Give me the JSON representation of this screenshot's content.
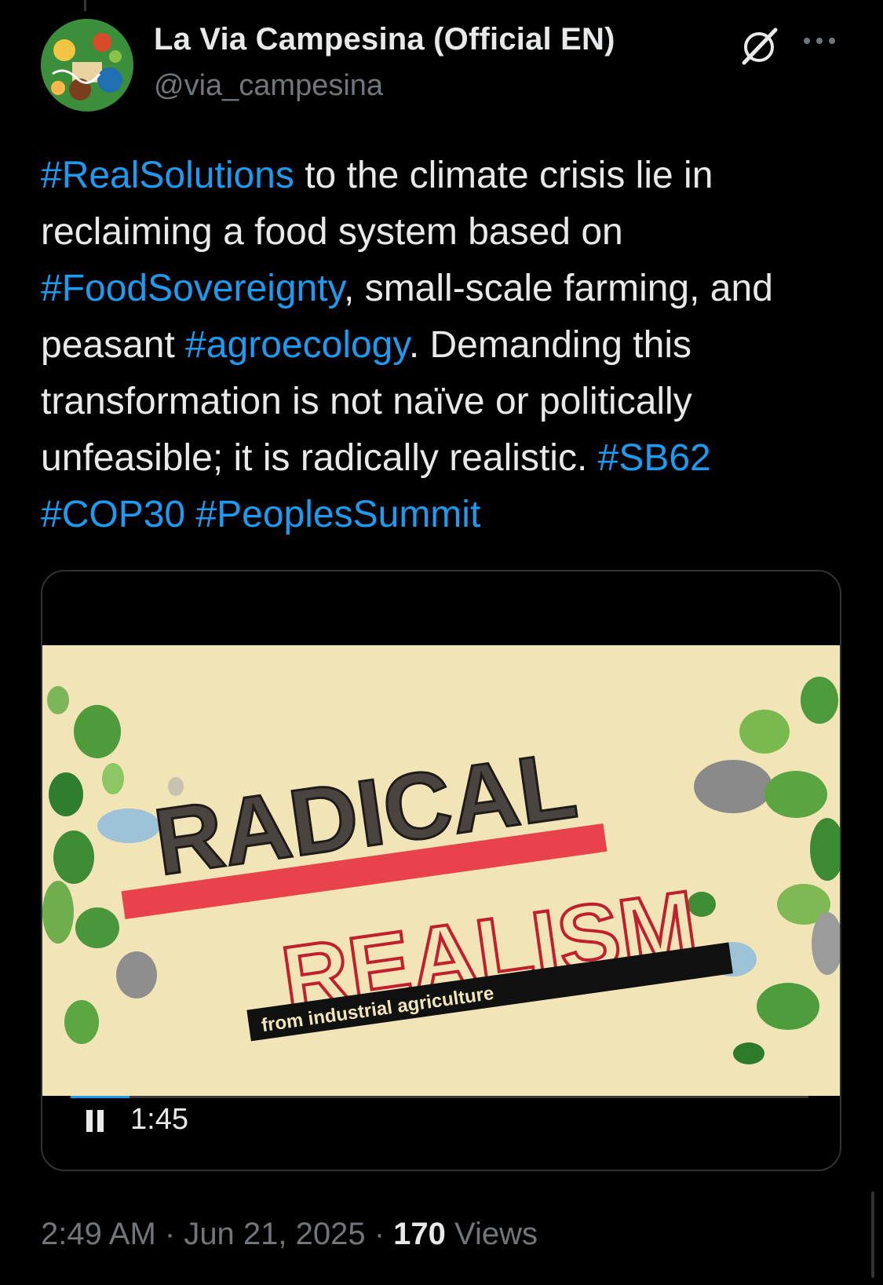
{
  "author": {
    "display_name": "La Via Campesina (Official EN)",
    "handle": "@via_campesina"
  },
  "icons": {
    "grok": "grok-icon",
    "more": "more-options-icon",
    "pause": "pause-icon"
  },
  "tweet": {
    "segments": [
      {
        "text": "#RealSolutions",
        "type": "hashtag"
      },
      {
        "text": " to the climate crisis lie in reclaiming a food system based on ",
        "type": "text"
      },
      {
        "text": "#FoodSovereignty",
        "type": "hashtag"
      },
      {
        "text": ", small-scale farming, and peasant ",
        "type": "text"
      },
      {
        "text": "#agroecology",
        "type": "hashtag"
      },
      {
        "text": ". Demanding this transformation is not naïve or politically unfeasible; it is radically realistic. ",
        "type": "text"
      },
      {
        "text": "#SB62",
        "type": "hashtag"
      },
      {
        "text": " ",
        "type": "text"
      },
      {
        "text": "#COP30",
        "type": "hashtag"
      },
      {
        "text": " ",
        "type": "text"
      },
      {
        "text": "#PeoplesSummit",
        "type": "hashtag"
      }
    ]
  },
  "video": {
    "title_line1": "RADICAL",
    "title_line2": "REALISM",
    "banner_text": "from industrial agriculture",
    "time_remaining": "1:45",
    "progress_fraction": 0.08
  },
  "meta": {
    "time": "2:49 AM",
    "separator": " · ",
    "date": "Jun 21, 2025",
    "views_count": "170",
    "views_label": "Views"
  },
  "colors": {
    "link": "#1d9bf0",
    "text": "#e7e9ea",
    "muted": "#71767b",
    "background": "#000000",
    "video_bg": "#f1e5b8",
    "accent_red": "#e8424a"
  }
}
